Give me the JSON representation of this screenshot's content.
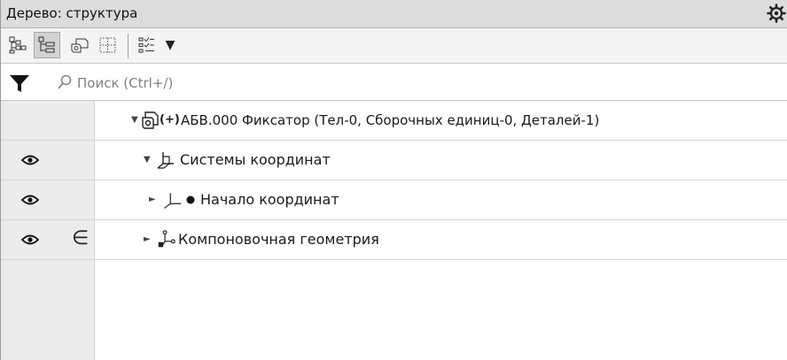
{
  "panel": {
    "title": "Дерево: структура"
  },
  "toolbar": {
    "dropdown_arrow": "▼"
  },
  "search": {
    "placeholder": "Поиск (Ctrl+/)",
    "value": ""
  },
  "tree": {
    "rows": [
      {
        "label": "АБВ.000 Фиксатор (Тел-0, Сборочных единиц-0, Деталей-1)",
        "prefix": "(+)",
        "expanded": true,
        "visible_eye": false,
        "marker": ""
      },
      {
        "label": "Системы координат",
        "expanded": true,
        "visible_eye": true,
        "marker": ""
      },
      {
        "label": "Начало координат",
        "expanded": false,
        "visible_eye": true,
        "marker": ""
      },
      {
        "label": "Компоновочная геометрия",
        "expanded": false,
        "visible_eye": true,
        "marker": "∈"
      }
    ]
  },
  "icons": {
    "settings": "gear-icon",
    "filter": "filter-icon",
    "search": "search-icon",
    "visibility": "eye-icon"
  },
  "colors": {
    "title_bg": "#dcdcdc",
    "active_button_bg": "#d2d2d2",
    "gutter_bg": "#ececec"
  }
}
